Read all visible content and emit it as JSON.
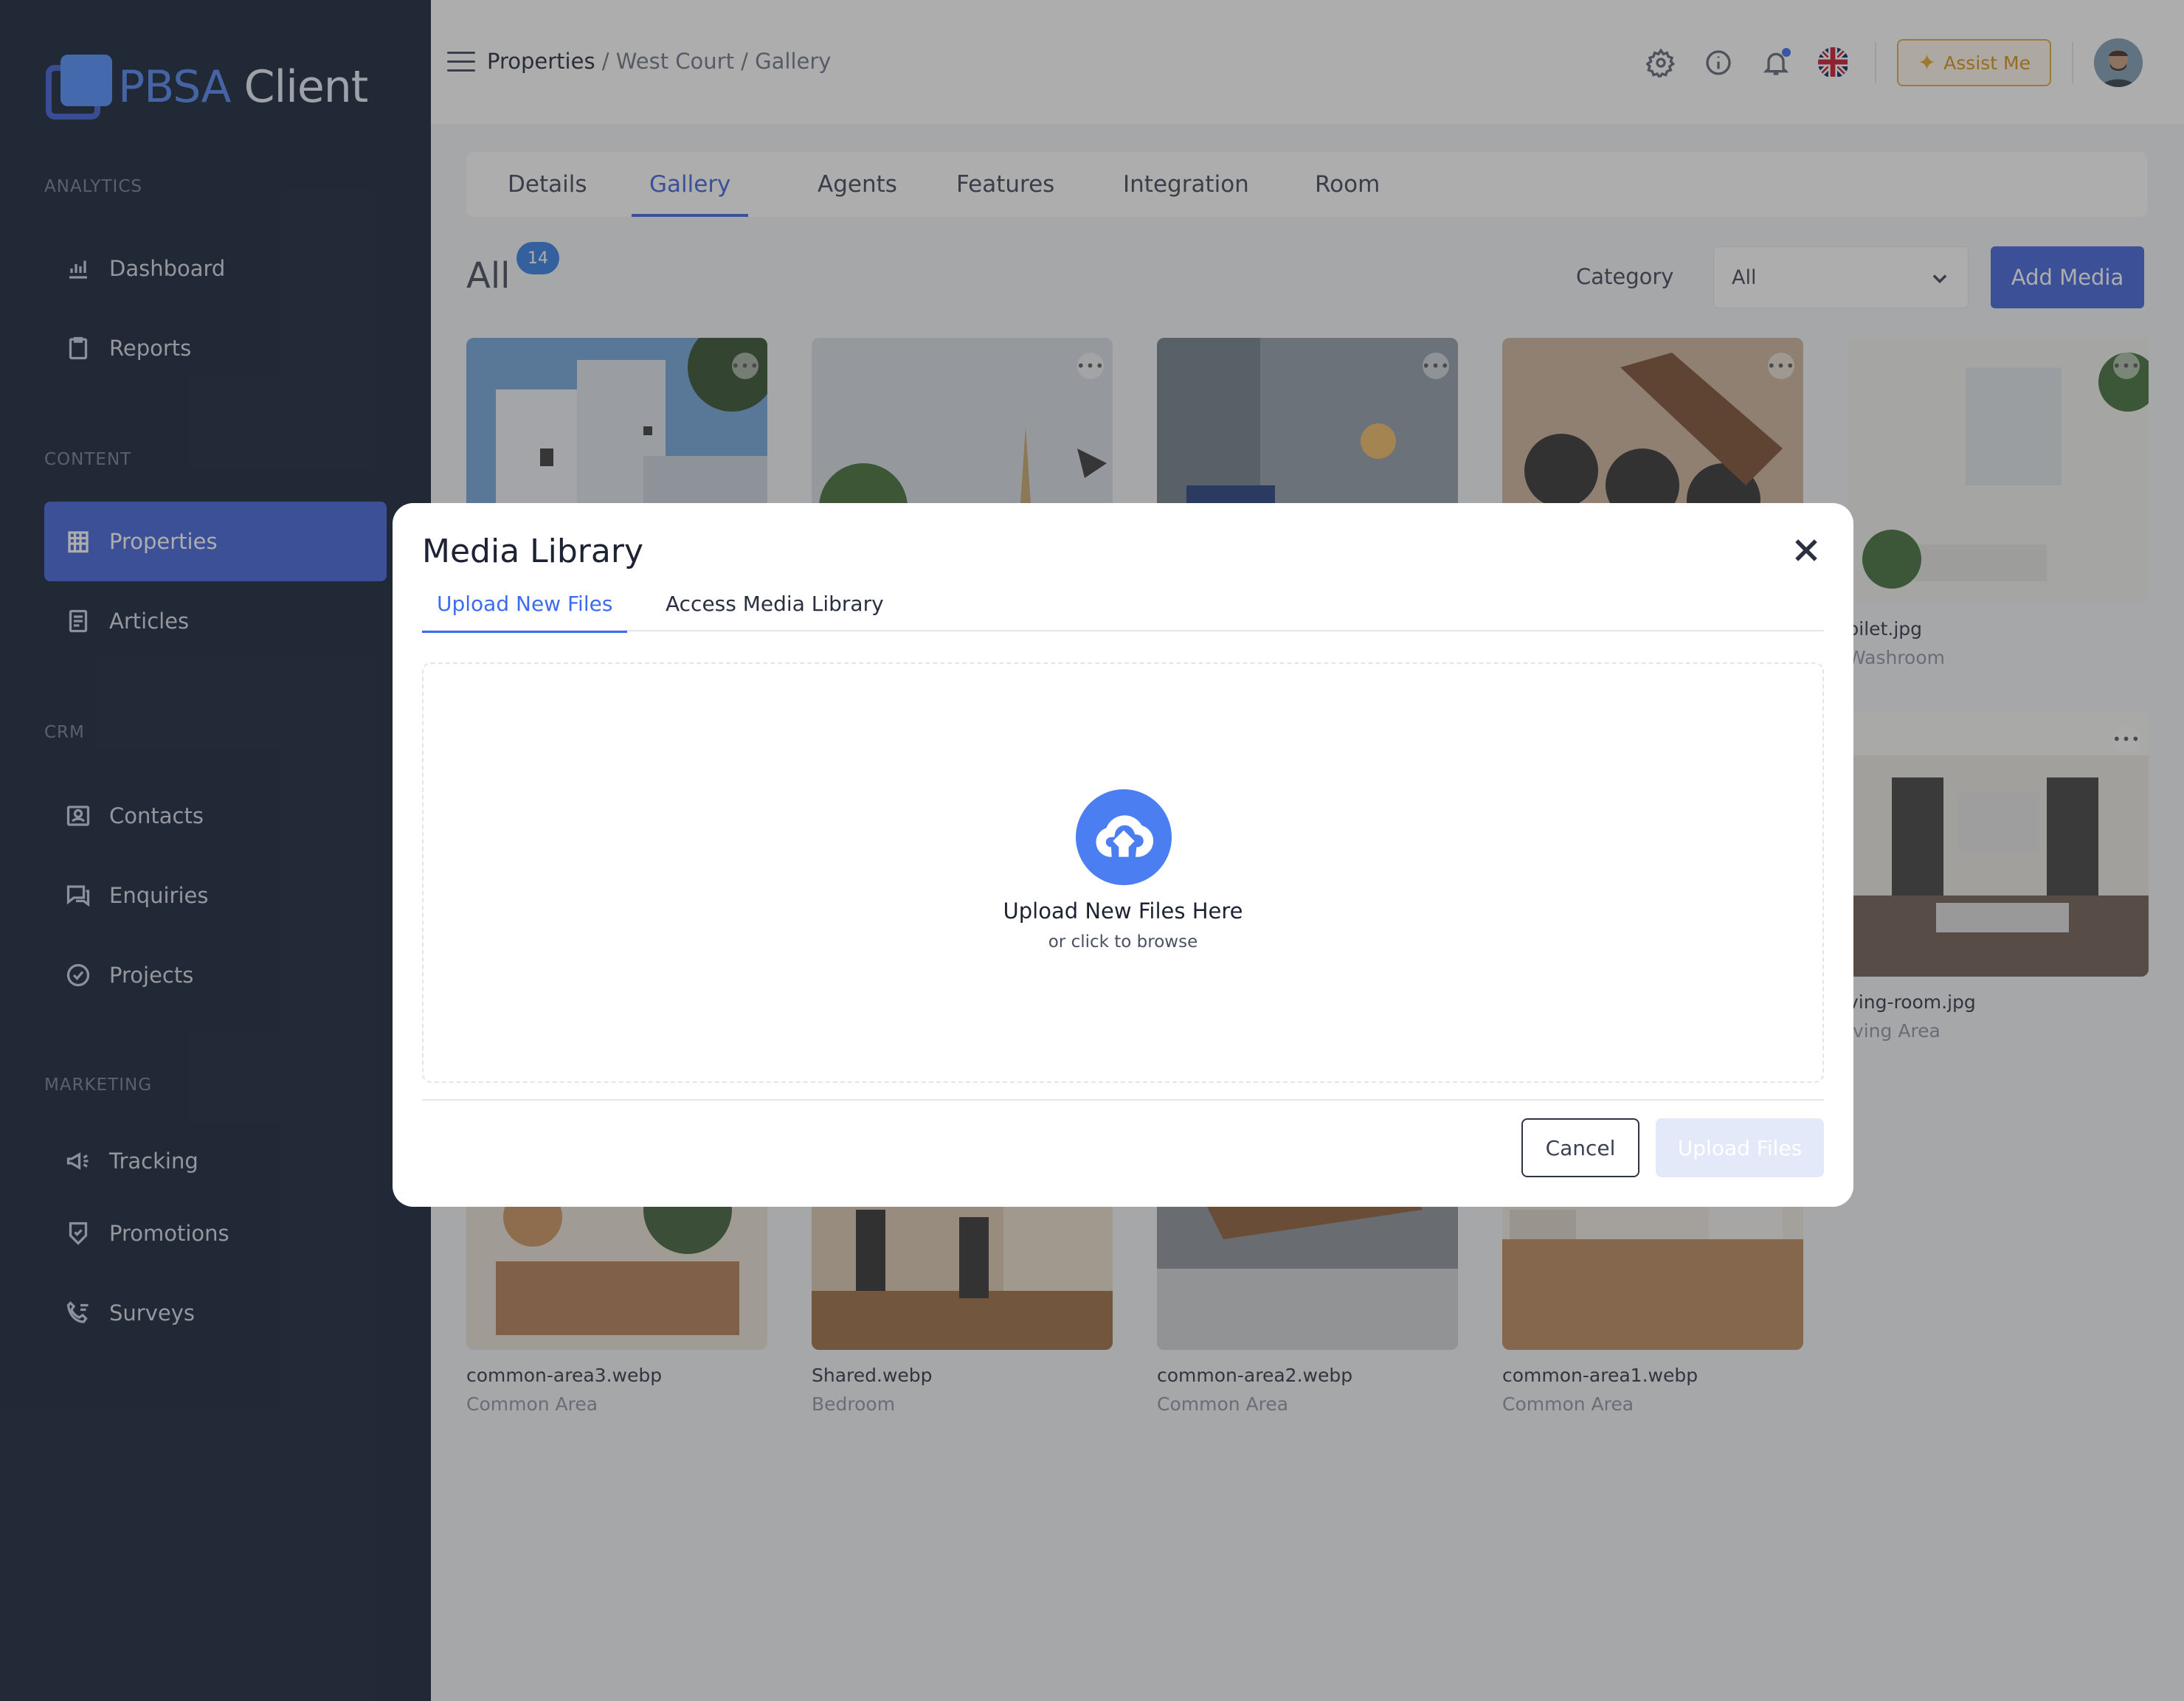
{
  "brand": {
    "part1": "PBSA",
    "part2": "Client"
  },
  "sidebar": {
    "sections": [
      {
        "label": "ANALYTICS"
      },
      {
        "label": "CONTENT"
      },
      {
        "label": "CRM"
      },
      {
        "label": "MARKETING"
      }
    ],
    "items": [
      {
        "label": "Dashboard",
        "icon": "bar-chart-icon"
      },
      {
        "label": "Reports",
        "icon": "clipboard-icon"
      },
      {
        "label": "Properties",
        "icon": "building-icon",
        "active": true
      },
      {
        "label": "Articles",
        "icon": "document-icon"
      },
      {
        "label": "Contacts",
        "icon": "contact-card-icon"
      },
      {
        "label": "Enquiries",
        "icon": "chat-icon"
      },
      {
        "label": "Projects",
        "icon": "check-circle-icon"
      },
      {
        "label": "Tracking",
        "icon": "megaphone-icon"
      },
      {
        "label": "Promotions",
        "icon": "shield-check-icon"
      },
      {
        "label": "Surveys",
        "icon": "phone-list-icon"
      }
    ]
  },
  "header": {
    "breadcrumb": {
      "first": "Properties",
      "rest": " / West Court / Gallery"
    },
    "assist_label": "Assist Me"
  },
  "tabs": [
    {
      "label": "Details"
    },
    {
      "label": "Gallery",
      "active": true
    },
    {
      "label": "Agents"
    },
    {
      "label": "Features"
    },
    {
      "label": "Integration"
    },
    {
      "label": "Room"
    }
  ],
  "gallery": {
    "title": "All",
    "count": "14",
    "category_label": "Category",
    "category_value": "All",
    "add_media_label": "Add Media",
    "visible_items": [
      {
        "name": "oilet.jpg",
        "category": "Washroom"
      },
      {
        "name": "ving-room.jpg",
        "category": "iving Area"
      },
      {
        "name": "common-area3.webp",
        "category": "Common Area"
      },
      {
        "name": "Shared.webp",
        "category": "Bedroom"
      },
      {
        "name": "common-area2.webp",
        "category": "Common Area"
      },
      {
        "name": "common-area1.webp",
        "category": "Common Area"
      }
    ]
  },
  "modal": {
    "title": "Media Library",
    "tabs": [
      {
        "label": "Upload New Files",
        "active": true
      },
      {
        "label": "Access Media Library"
      }
    ],
    "dropzone_title": "Upload New Files Here",
    "dropzone_sub": "or click to browse",
    "cancel_label": "Cancel",
    "upload_label": "Upload Files"
  },
  "colors": {
    "accent": "#3c5fd8",
    "sidebar_bg": "#0f1c33",
    "assist": "#e1a83b"
  }
}
